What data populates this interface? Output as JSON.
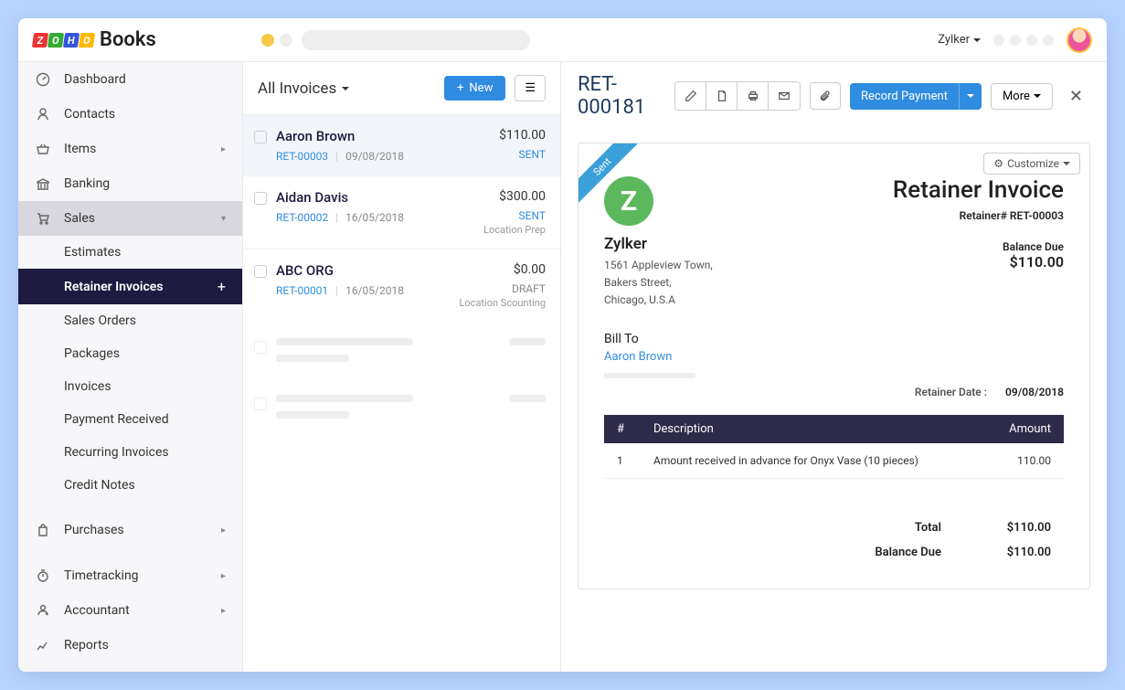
{
  "brand": {
    "books": "Books",
    "z": "Z",
    "o": "O",
    "h": "H",
    "o2": "O"
  },
  "topbar": {
    "org_name": "Zylker"
  },
  "sidebar": {
    "items": [
      {
        "label": "Dashboard",
        "icon": "gauge-icon"
      },
      {
        "label": "Contacts",
        "icon": "user-icon"
      },
      {
        "label": "Items",
        "icon": "basket-icon",
        "expandable": true
      },
      {
        "label": "Banking",
        "icon": "bank-icon"
      },
      {
        "label": "Sales",
        "icon": "cart-icon",
        "expandable": true,
        "expanded": true
      },
      {
        "label": "Purchases",
        "icon": "bag-icon",
        "expandable": true
      },
      {
        "label": "Timetracking",
        "icon": "stopwatch-icon",
        "expandable": true
      },
      {
        "label": "Accountant",
        "icon": "accountant-icon",
        "expandable": true
      },
      {
        "label": "Reports",
        "icon": "chart-icon"
      }
    ],
    "sales_sub": [
      "Estimates",
      "Retainer Invoices",
      "Sales Orders",
      "Packages",
      "Invoices",
      "Payment Received",
      "Recurring Invoices",
      "Credit Notes"
    ]
  },
  "list": {
    "title": "All Invoices",
    "new_label": "New",
    "rows": [
      {
        "name": "Aaron Brown",
        "ref": "RET-00003",
        "date": "09/08/2018",
        "amount": "$110.00",
        "status": "SENT",
        "note": "",
        "selected": true
      },
      {
        "name": "Aidan Davis",
        "ref": "RET-00002",
        "date": "16/05/2018",
        "amount": "$300.00",
        "status": "SENT",
        "note": "Location Prep"
      },
      {
        "name": "ABC ORG",
        "ref": "RET-00001",
        "date": "16/05/2018",
        "amount": "$0.00",
        "status": "DRAFT",
        "note": "Location Scounting"
      }
    ]
  },
  "detail": {
    "title": "RET-000181",
    "record_payment_label": "Record Payment",
    "more_label": "More",
    "customize_label": "Customize",
    "ribbon": "Sent",
    "company": {
      "logo_letter": "Z",
      "name": "Zylker",
      "addr1": "1561 Appleview Town,",
      "addr2": "Bakers Street,",
      "addr3": "Chicago, U.S.A"
    },
    "invoice_title": "Retainer Invoice",
    "retainer_no_label": "Retainer# RET-00003",
    "balance_due_label": "Balance Due",
    "balance_due_amount": "$110.00",
    "billto_label": "Bill To",
    "billto_name": "Aaron Brown",
    "retainer_date_label": "Retainer Date :",
    "retainer_date_value": "09/08/2018",
    "table_head": {
      "num": "#",
      "desc": "Description",
      "amt": "Amount"
    },
    "lines": [
      {
        "num": "1",
        "desc": "Amount received in advance for Onyx Vase (10 pieces)",
        "amt": "110.00"
      }
    ],
    "totals": {
      "total_label": "Total",
      "total_value": "$110.00",
      "balance_label": "Balance Due",
      "balance_value": "$110.00"
    }
  }
}
